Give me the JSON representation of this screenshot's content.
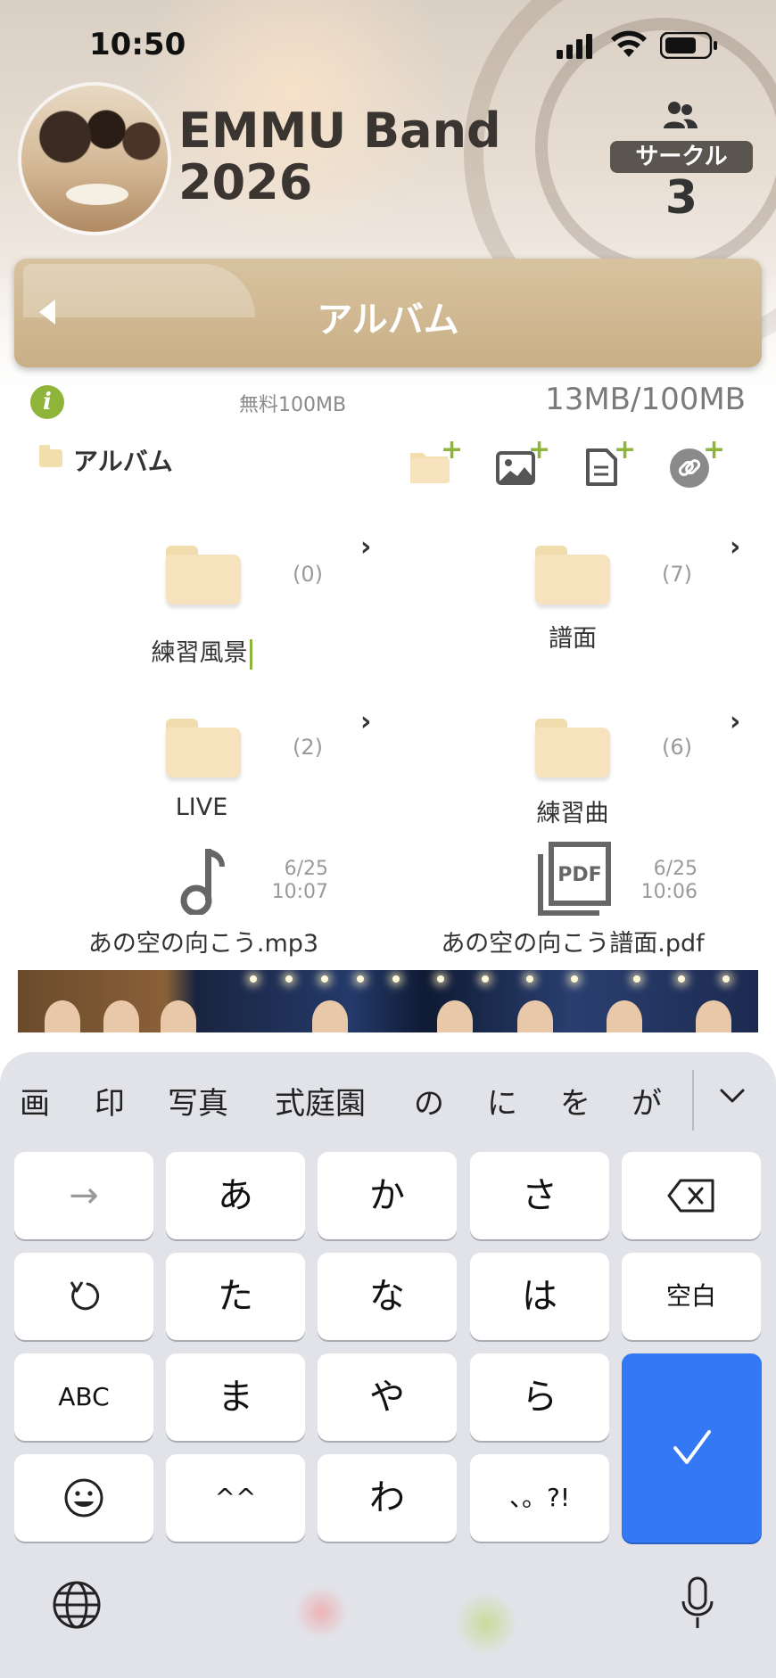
{
  "status_bar": {
    "time": "10:50"
  },
  "header": {
    "band_name": "EMMU Band 2026",
    "circle_label": "サークル",
    "circle_count": "3"
  },
  "album_bar": {
    "title": "アルバム"
  },
  "storage": {
    "info_glyph": "i",
    "plan_label": "無料100MB",
    "usage": "13MB/100MB"
  },
  "toolbar": {
    "breadcrumb": "アルバム",
    "icons": [
      "new-folder-icon",
      "add-image-icon",
      "add-document-icon",
      "add-link-icon"
    ],
    "plus_glyph": "+"
  },
  "folders": [
    {
      "name": "練習風景",
      "count": "(0)"
    },
    {
      "name": "譜面",
      "count": "(7)"
    },
    {
      "name": "LIVE",
      "count": "(2)"
    },
    {
      "name": "練習曲",
      "count": "(6)"
    }
  ],
  "chevron_glyph": "›",
  "files": [
    {
      "name": "あの空の向こう.mp3",
      "date": "6/25",
      "time": "10:07",
      "icon": "music-note-icon"
    },
    {
      "name": "あの空の向こう譜面.pdf",
      "date": "6/25",
      "time": "10:06",
      "icon": "pdf-icon",
      "icon_text": "PDF"
    }
  ],
  "keyboard": {
    "candidates": [
      "画",
      "印",
      "写真",
      "式庭園",
      "の",
      "に",
      "を",
      "が"
    ],
    "rows": [
      [
        "→",
        "あ",
        "か",
        "さ",
        ""
      ],
      [
        "",
        "た",
        "な",
        "は",
        "空白"
      ],
      [
        "ABC",
        "ま",
        "や",
        "ら"
      ],
      [
        "",
        "^^",
        "わ",
        "、。?!"
      ]
    ],
    "enter_glyph": "✓",
    "emoji_glyph": "☺"
  },
  "colors": {
    "accent_green": "#8fb43a",
    "album_bar": "#c8af86",
    "enter_blue": "#3478f6"
  }
}
